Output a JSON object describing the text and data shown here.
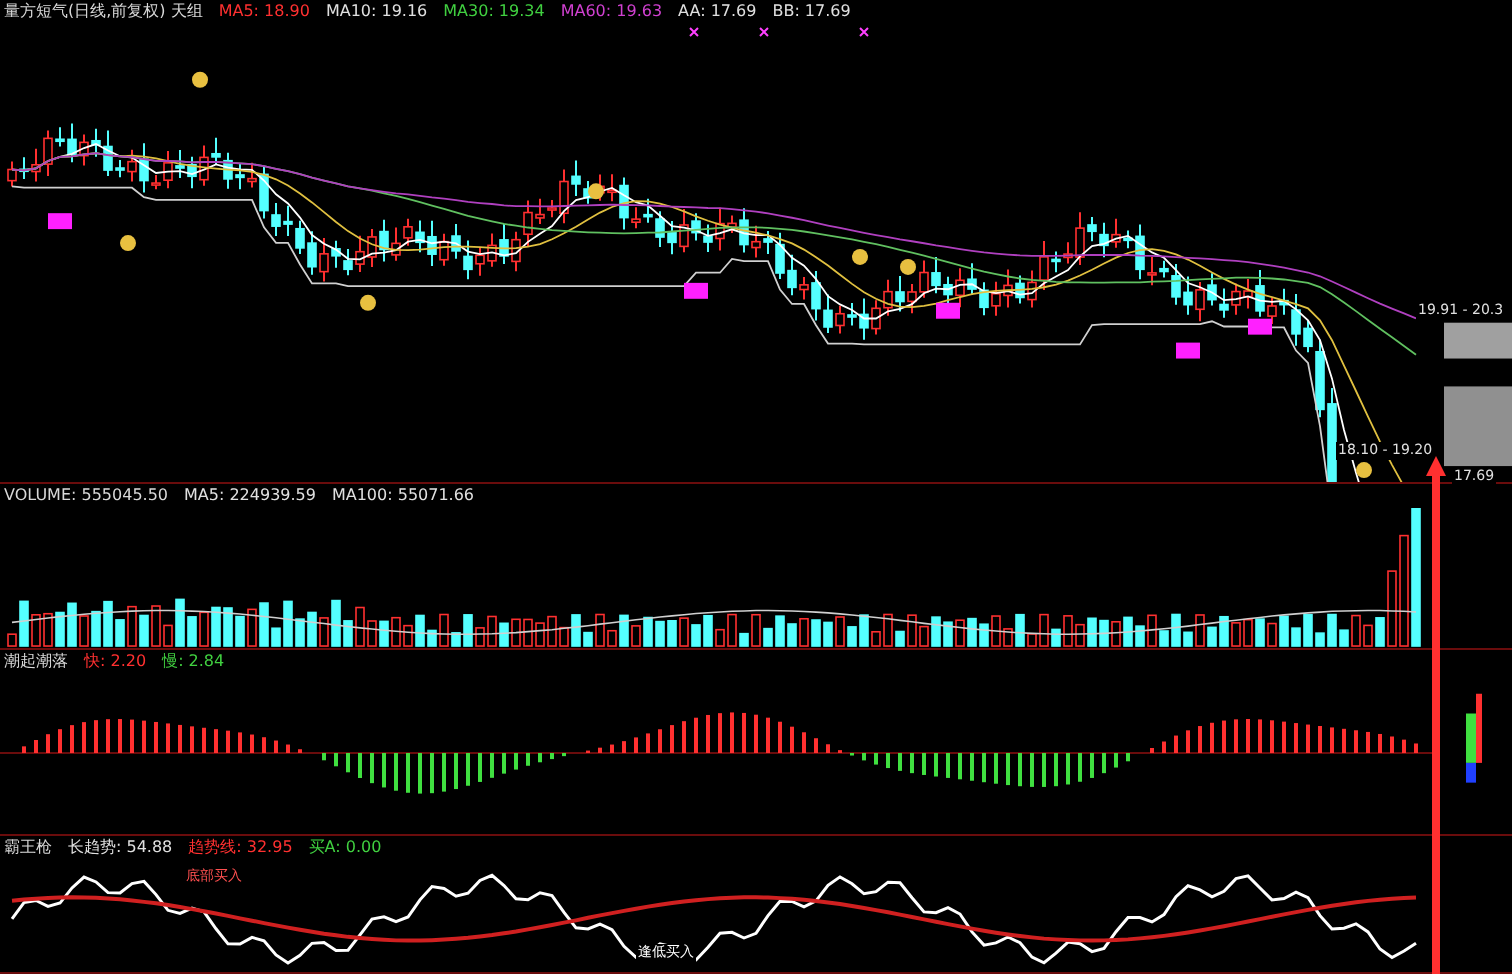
{
  "main_panel": {
    "title": "量方短气(日线,前复权) 天组",
    "indicators": [
      {
        "label": "MA5: 18.90",
        "color": "#ff3030"
      },
      {
        "label": "MA10: 19.16",
        "color": "#e0e0e0"
      },
      {
        "label": "MA30: 19.34",
        "color": "#40d040"
      },
      {
        "label": "MA60: 19.63",
        "color": "#d040d0"
      },
      {
        "label": "AA: 17.69",
        "color": "#e0e0e0"
      },
      {
        "label": "BB: 17.69",
        "color": "#e0e0e0"
      }
    ],
    "price_labels": [
      "19.91 - 20.3",
      "18.10 - 19.20",
      "17.69"
    ]
  },
  "volume_panel": {
    "title": "VOLUME: 555045.50",
    "indicators": [
      {
        "label": "MA5: 224939.59",
        "color": "#e0e0e0"
      },
      {
        "label": "MA100: 55071.66",
        "color": "#e0e0e0"
      }
    ]
  },
  "oscillator_panel": {
    "title": "潮起潮落",
    "indicators": [
      {
        "label": "快: 2.20",
        "color": "#ff3030"
      },
      {
        "label": "慢: 2.84",
        "color": "#40d040"
      }
    ]
  },
  "trend_panel": {
    "title": "霸王枪",
    "indicators": [
      {
        "label": "长趋势: 54.88",
        "color": "#e0e0e0"
      },
      {
        "label": "趋势线: 32.95",
        "color": "#ff3030"
      },
      {
        "label": "买A: 0.00",
        "color": "#40d040"
      }
    ],
    "chart_labels": [
      "底部买入",
      "逢低买入"
    ]
  }
}
